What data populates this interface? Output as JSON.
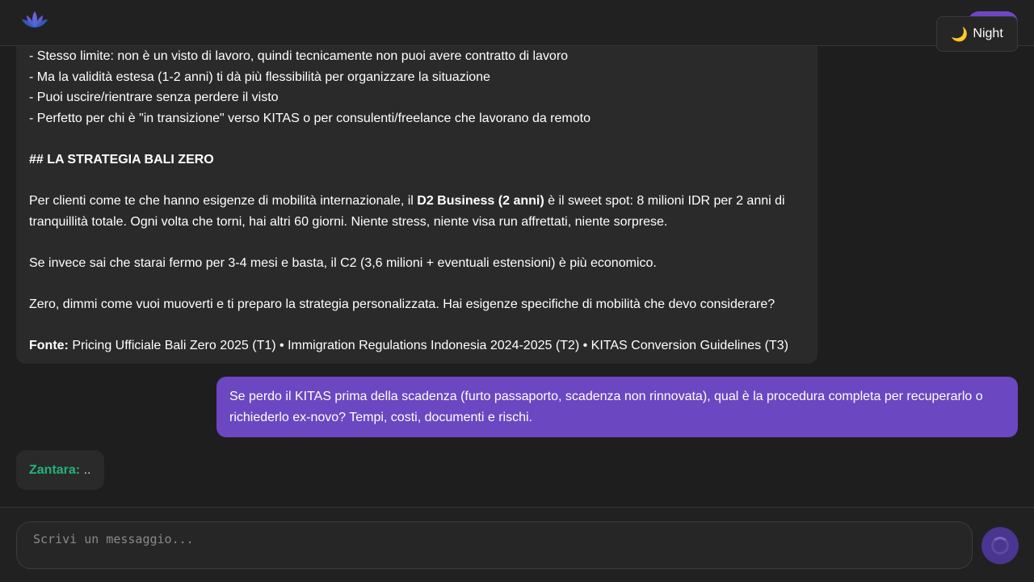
{
  "header": {
    "theme_toggle_label": "Night",
    "theme_toggle_icon": "moon-icon"
  },
  "bot_message": {
    "lines": [
      "- Stesso limite: non è un visto di lavoro, quindi tecnicamente non puoi avere contratto di lavoro",
      "- Ma la validità estesa (1-2 anni) ti dà più flessibilità per organizzare la situazione",
      "- Puoi uscire/rientrare senza perdere il visto",
      "- Perfetto per chi è \"in transizione\" verso KITAS o per consulenti/freelance che lavorano da remoto"
    ],
    "heading": "## LA STRATEGIA BALI ZERO",
    "strategy_pre": "Per clienti come te che hanno esigenze di mobilità internazionale, il ",
    "strategy_bold": "D2 Business (2 anni)",
    "strategy_post": " è il sweet spot: 8 milioni IDR per 2 anni di tranquillità totale. Ogni volta che torni, hai altri 60 giorni. Niente stress, niente visa run affrettati, niente sorprese.",
    "alternative": "Se invece sai che starai fermo per 3-4 mesi e basta, il C2 (3,6 milioni + eventuali estensioni) è più economico.",
    "closing": "Zero, dimmi come vuoi muoverti e ti preparo la strategia personalizzata. Hai esigenze specifiche di mobilità che devo considerare?",
    "source_label": "Fonte:",
    "source_text": " Pricing Ufficiale Bali Zero 2025 (T1) • Immigration Regulations Indonesia 2024-2025 (T2) • KITAS Conversion Guidelines (T3)"
  },
  "user_message": {
    "text": "Se perdo il KITAS prima della scadenza (furto passaporto, scadenza non rinnovata), qual è la procedura completa per recuperarlo o richiederlo ex-novo? Tempi, costi, documenti e rischi."
  },
  "typing_indicator": {
    "sender": "Zantara:",
    "text": " .."
  },
  "composer": {
    "placeholder": "Scrivi un messaggio...",
    "value": ""
  },
  "colors": {
    "accent": "#6b47c2",
    "sender": "#22b37a",
    "background": "#1e1e1e",
    "bubble": "#2a2a2a"
  }
}
